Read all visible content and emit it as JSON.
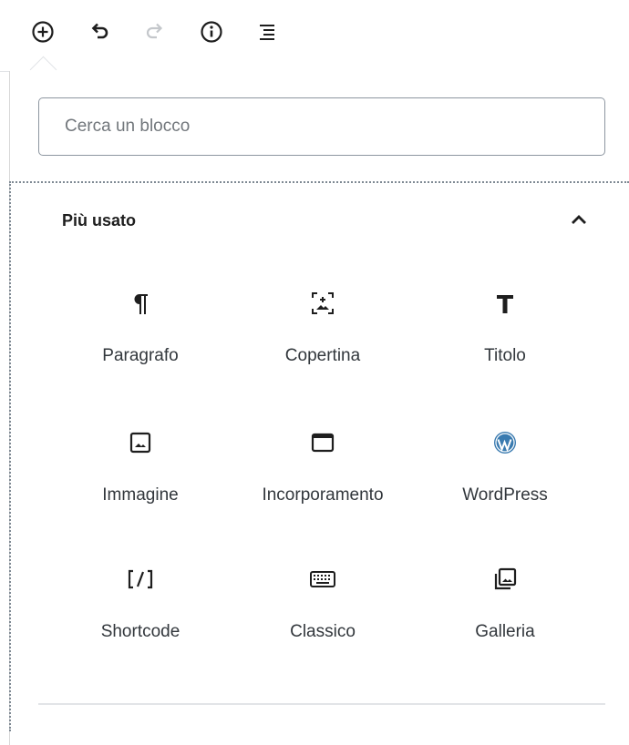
{
  "toolbar": {
    "add_icon": "plus-circle-icon",
    "undo_icon": "undo-icon",
    "redo_icon": "redo-icon",
    "info_icon": "info-icon",
    "outline_icon": "list-outline-icon"
  },
  "search": {
    "placeholder": "Cerca un blocco"
  },
  "panel": {
    "title": "Più usato",
    "toggle_icon": "chevron-up-icon",
    "blocks": [
      {
        "label": "Paragrafo",
        "icon": "paragraph-icon"
      },
      {
        "label": "Copertina",
        "icon": "cover-image-icon"
      },
      {
        "label": "Titolo",
        "icon": "heading-icon"
      },
      {
        "label": "Immagine",
        "icon": "image-icon"
      },
      {
        "label": "Incorporamento",
        "icon": "embed-window-icon"
      },
      {
        "label": "WordPress",
        "icon": "wordpress-logo-icon"
      },
      {
        "label": "Shortcode",
        "icon": "shortcode-icon"
      },
      {
        "label": "Classico",
        "icon": "keyboard-icon"
      },
      {
        "label": "Galleria",
        "icon": "gallery-icon"
      }
    ]
  },
  "colors": {
    "icon": "#1e1e1e",
    "wordpress": "#3a7bb0",
    "border": "#8d96a0"
  }
}
